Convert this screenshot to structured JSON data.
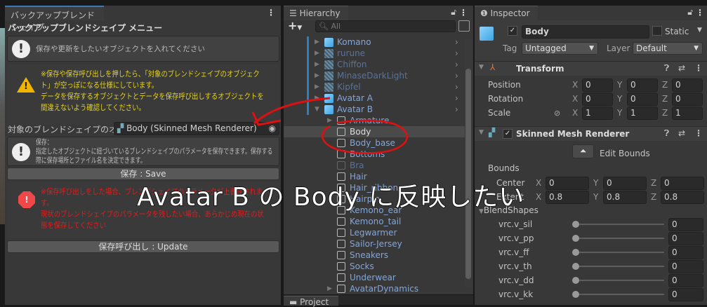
{
  "backup_panel": {
    "tab": "バックアップブレンドシェイプ",
    "title": "バックアップブレンドシェイプ メニュー",
    "info1": "保存や更新をしたいオブジェクトを入れてください",
    "warning": [
      "※保存や保存呼び出しを押したら、「対象のブレンドシェイプのオブジェク",
      "ト」が空っぽになる仕様にしています。",
      "データを保存するオブジェクトとデータを保存呼び出しするオブジェクトを",
      "間違えないよう確認してください。"
    ],
    "target_label": "対象のブレンドシェイプのオブジェ",
    "target_value": "Body (Skinned Mesh Renderer)",
    "save_info": [
      "保存：",
      "指定したオブジェクトに紐づいているブレンドシェイプのパラメータを保存できます。保存する",
      "際に保存場所とファイル名を決定できます。"
    ],
    "save_button": "保存 : Save",
    "error": [
      "※保存呼び出しをした場合、ブレンドシェイプのパラメータが上書きされま",
      "す。",
      "現状のブレンドシェイプのパラメータを残したい場合、あらかじめ現在の状",
      "態を保存してください"
    ],
    "update_button": "保存呼び出し : Update"
  },
  "hierarchy": {
    "tab": "Hierarchy",
    "search_placeholder": "All",
    "items": [
      {
        "name": "Komano",
        "type": "prefab"
      },
      {
        "name": "rurune",
        "type": "prefab-inactive"
      },
      {
        "name": "Chiffon",
        "type": "prefab-inactive"
      },
      {
        "name": "MinaseDarkLight",
        "type": "prefab-inactive"
      },
      {
        "name": "Kipfel",
        "type": "prefab-inactive"
      },
      {
        "name": "Avatar A",
        "type": "prefab"
      },
      {
        "name": "Avatar B",
        "type": "prefab"
      },
      {
        "name": "Armature",
        "type": "child"
      },
      {
        "name": "Body",
        "type": "child-selected"
      },
      {
        "name": "Body_base",
        "type": "child"
      },
      {
        "name": "Bottoms",
        "type": "child"
      },
      {
        "name": "Bra",
        "type": "child-inactive"
      },
      {
        "name": "Hair",
        "type": "child"
      },
      {
        "name": "Hair_ribbon",
        "type": "child"
      },
      {
        "name": "Hairpin",
        "type": "child"
      },
      {
        "name": "Kemono_ear",
        "type": "child"
      },
      {
        "name": "Kemono_tail",
        "type": "child"
      },
      {
        "name": "Legwarmer",
        "type": "child"
      },
      {
        "name": "Sailor-Jersey",
        "type": "child"
      },
      {
        "name": "Sneakers",
        "type": "child"
      },
      {
        "name": "Socks",
        "type": "child"
      },
      {
        "name": "Underwear",
        "type": "child"
      },
      {
        "name": "AvatarDynamics",
        "type": "child"
      }
    ],
    "project_tab": "Project"
  },
  "inspector": {
    "tab": "Inspector",
    "object_name": "Body",
    "static_label": "Static",
    "tag_label": "Tag",
    "tag_value": "Untagged",
    "layer_label": "Layer",
    "layer_value": "Default",
    "transform": {
      "title": "Transform",
      "rows": [
        {
          "label": "Position",
          "x": "0",
          "y": "0",
          "z": "0"
        },
        {
          "label": "Rotation",
          "x": "0",
          "y": "0",
          "z": "0"
        },
        {
          "label": "Scale",
          "x": "1",
          "y": "1",
          "z": "1"
        }
      ]
    },
    "smr": {
      "title": "Skinned Mesh Renderer",
      "edit_bounds": "Edit Bounds",
      "bounds_label": "Bounds",
      "center": {
        "label": "Center",
        "x": "0",
        "y": "0",
        "z": "0"
      },
      "extent": {
        "label": "Extent",
        "x": "0.8",
        "y": "0.8",
        "z": "0.8"
      },
      "blendshapes_label": "BlendShapes",
      "blendshapes": [
        {
          "name": "vrc.v_sil",
          "value": "0"
        },
        {
          "name": "vrc.v_pp",
          "value": "0"
        },
        {
          "name": "vrc.v_ff",
          "value": "0"
        },
        {
          "name": "vrc.v_th",
          "value": "0"
        },
        {
          "name": "vrc.v_dd",
          "value": "0"
        },
        {
          "name": "vrc.v_kk",
          "value": "0"
        }
      ]
    },
    "axes": {
      "x": "X",
      "y": "Y",
      "z": "Z"
    }
  },
  "overlay_caption": "Avatar B の Body に反映したい"
}
